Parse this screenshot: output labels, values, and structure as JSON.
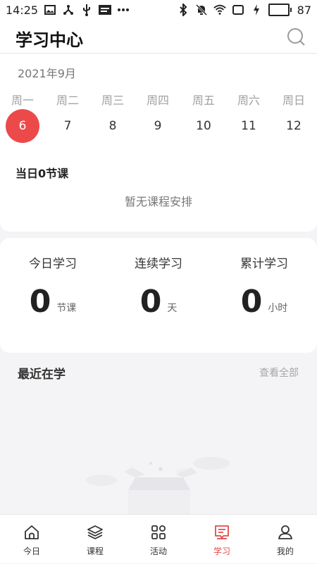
{
  "status_bar": {
    "time": "14:25",
    "battery": "87",
    "battery_fraction": 0.87,
    "left_icons": [
      "gallery-icon",
      "share-icon",
      "usb-icon",
      "news-icon",
      "more-dots-icon"
    ],
    "right_icons": [
      "bluetooth-icon",
      "mute-icon",
      "wifi-icon",
      "screen-icon",
      "charging-icon"
    ]
  },
  "header": {
    "title": "学习中心",
    "search_icon": "search-icon"
  },
  "calendar": {
    "month": "2021年9月",
    "weekdays": [
      "周一",
      "周二",
      "周三",
      "周四",
      "周五",
      "周六",
      "周日"
    ],
    "days": [
      "6",
      "7",
      "8",
      "9",
      "10",
      "11",
      "12"
    ],
    "selected_day": "6",
    "selected_color": "#ec4a4a",
    "course_count": "当日0节课",
    "empty_note": "暂无课程安排"
  },
  "stats": [
    {
      "label": "今日学习",
      "value": "0",
      "unit": "节课"
    },
    {
      "label": "连续学习",
      "value": "0",
      "unit": "天"
    },
    {
      "label": "累计学习",
      "value": "0",
      "unit": "小时"
    }
  ],
  "recent": {
    "title": "最近在学",
    "view_all": "查看全部"
  },
  "bottom_nav": {
    "active_color": "#e24a4a",
    "items": [
      {
        "label": "今日",
        "icon": "home-icon",
        "active": false
      },
      {
        "label": "课程",
        "icon": "layers-icon",
        "active": false
      },
      {
        "label": "活动",
        "icon": "grid-icon",
        "active": false
      },
      {
        "label": "学习",
        "icon": "study-icon",
        "active": true
      },
      {
        "label": "我的",
        "icon": "user-icon",
        "active": false
      }
    ]
  }
}
